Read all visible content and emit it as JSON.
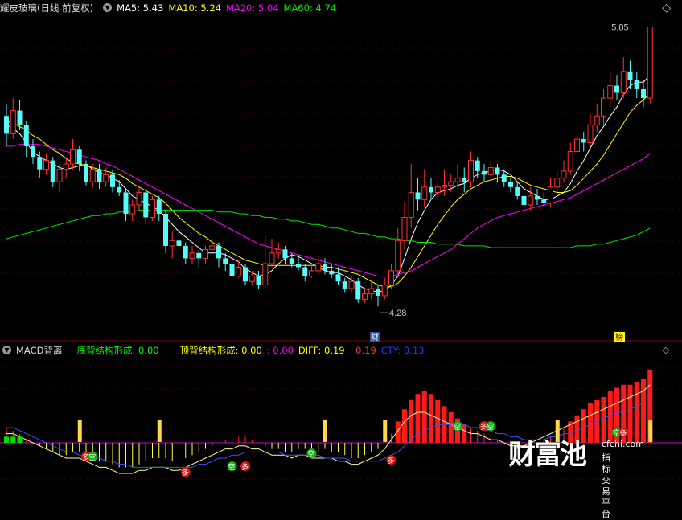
{
  "header": {
    "stock_name": "耀皮玻璃(日线 前复权)",
    "ma5": "MA5: 5.43",
    "ma10": "MA10: 5.24",
    "ma20": "MA20: 5.04",
    "ma60": "MA60: 4.74"
  },
  "indicator_header": {
    "name": "MACD背离",
    "bottom_div": "底背结构形成: 0.00",
    "top_div": "顶背结构形成: 0.00",
    "val3": ": 0.00",
    "diff": "DIFF: 0.19",
    "val5": ": 0.19",
    "cty": "CTY: 0.13"
  },
  "colors": {
    "up": "#ff3232",
    "down": "#54fcfc",
    "ma5": "#ffffff",
    "ma10": "#ffff00",
    "ma20": "#ff00ff",
    "ma60": "#00e600",
    "diff_label": "#00ff00"
  },
  "annotations": {
    "high_label": "5.85",
    "low_label": "4.28",
    "cai_badge": "财",
    "rong_badge": "榜",
    "duo": "多",
    "kong": "空"
  },
  "watermark": {
    "big": "财富池",
    "url": "cfchi.com",
    "slogan": "指标交易平台"
  },
  "chart_data": {
    "type": "candlestick",
    "high_marker": 5.85,
    "low_marker": 4.28,
    "candles": [
      [
        0,
        5.35,
        5.25,
        5.42,
        5.18
      ],
      [
        1,
        5.25,
        5.38,
        5.45,
        5.22
      ],
      [
        2,
        5.38,
        5.3,
        5.44,
        5.27
      ],
      [
        3,
        5.3,
        5.18,
        5.32,
        5.12
      ],
      [
        4,
        5.18,
        5.12,
        5.22,
        5.08
      ],
      [
        5,
        5.12,
        5.05,
        5.15,
        5.0
      ],
      [
        6,
        5.05,
        5.1,
        5.14,
        5.02
      ],
      [
        7,
        5.1,
        4.98,
        5.12,
        4.95
      ],
      [
        8,
        4.98,
        5.05,
        5.08,
        4.92
      ],
      [
        9,
        5.05,
        5.08,
        5.12,
        5.0
      ],
      [
        10,
        5.08,
        5.16,
        5.22,
        5.05
      ],
      [
        11,
        5.16,
        5.08,
        5.18,
        5.04
      ],
      [
        12,
        5.08,
        4.98,
        5.1,
        4.96
      ],
      [
        13,
        4.98,
        5.05,
        5.08,
        4.95
      ],
      [
        14,
        5.05,
        4.98,
        5.08,
        4.94
      ],
      [
        15,
        4.98,
        5.02,
        5.06,
        4.95
      ],
      [
        16,
        5.02,
        4.95,
        5.05,
        4.92
      ],
      [
        17,
        4.95,
        4.92,
        4.99,
        4.9
      ],
      [
        18,
        4.92,
        4.8,
        4.94,
        4.76
      ],
      [
        19,
        4.8,
        4.85,
        4.88,
        4.76
      ],
      [
        20,
        4.85,
        4.92,
        4.96,
        4.82
      ],
      [
        21,
        4.92,
        4.78,
        4.94,
        4.74
      ],
      [
        22,
        4.78,
        4.88,
        4.9,
        4.76
      ],
      [
        23,
        4.88,
        4.8,
        4.9,
        4.76
      ],
      [
        24,
        4.8,
        4.62,
        4.82,
        4.58
      ],
      [
        25,
        4.62,
        4.65,
        4.7,
        4.55
      ],
      [
        26,
        4.65,
        4.62,
        4.68,
        4.6
      ],
      [
        27,
        4.62,
        4.55,
        4.64,
        4.52
      ],
      [
        28,
        4.55,
        4.58,
        4.62,
        4.52
      ],
      [
        29,
        4.58,
        4.55,
        4.6,
        4.5
      ],
      [
        30,
        4.55,
        4.6,
        4.62,
        4.52
      ],
      [
        31,
        4.6,
        4.62,
        4.66,
        4.58
      ],
      [
        32,
        4.62,
        4.55,
        4.64,
        4.5
      ],
      [
        33,
        4.55,
        4.52,
        4.58,
        4.48
      ],
      [
        34,
        4.52,
        4.45,
        4.54,
        4.42
      ],
      [
        35,
        4.45,
        4.5,
        4.54,
        4.44
      ],
      [
        36,
        4.5,
        4.42,
        4.52,
        4.4
      ],
      [
        37,
        4.42,
        4.45,
        4.48,
        4.4
      ],
      [
        38,
        4.45,
        4.4,
        4.48,
        4.38
      ],
      [
        39,
        4.4,
        4.52,
        4.68,
        4.38
      ],
      [
        40,
        4.52,
        4.58,
        4.66,
        4.5
      ],
      [
        41,
        4.58,
        4.6,
        4.64,
        4.55
      ],
      [
        42,
        4.6,
        4.55,
        4.62,
        4.52
      ],
      [
        43,
        4.55,
        4.52,
        4.58,
        4.5
      ],
      [
        44,
        4.52,
        4.5,
        4.56,
        4.48
      ],
      [
        45,
        4.5,
        4.45,
        4.52,
        4.42
      ],
      [
        46,
        4.45,
        4.48,
        4.52,
        4.44
      ],
      [
        47,
        4.48,
        4.52,
        4.56,
        4.46
      ],
      [
        48,
        4.52,
        4.48,
        4.55,
        4.46
      ],
      [
        49,
        4.48,
        4.46,
        4.52,
        4.44
      ],
      [
        50,
        4.46,
        4.42,
        4.5,
        4.4
      ],
      [
        51,
        4.42,
        4.38,
        4.44,
        4.36
      ],
      [
        52,
        4.38,
        4.42,
        4.45,
        4.36
      ],
      [
        53,
        4.42,
        4.32,
        4.44,
        4.3
      ],
      [
        54,
        4.32,
        4.35,
        4.38,
        4.3
      ],
      [
        55,
        4.35,
        4.38,
        4.42,
        4.32
      ],
      [
        56,
        4.38,
        4.34,
        4.4,
        4.28
      ],
      [
        57,
        4.34,
        4.4,
        4.44,
        4.32
      ],
      [
        58,
        4.4,
        4.48,
        4.52,
        4.38
      ],
      [
        59,
        4.48,
        4.65,
        4.72,
        4.46
      ],
      [
        60,
        4.65,
        4.78,
        4.86,
        4.6
      ],
      [
        61,
        4.78,
        4.92,
        5.08,
        4.72
      ],
      [
        62,
        4.92,
        4.88,
        5.0,
        4.82
      ],
      [
        63,
        4.88,
        4.95,
        5.05,
        4.84
      ],
      [
        64,
        4.95,
        4.92,
        5.0,
        4.88
      ],
      [
        65,
        4.92,
        4.95,
        4.98,
        4.88
      ],
      [
        66,
        4.95,
        4.96,
        5.05,
        4.9
      ],
      [
        67,
        4.96,
        4.98,
        5.02,
        4.92
      ],
      [
        68,
        4.98,
        5.0,
        5.08,
        4.94
      ],
      [
        69,
        5.0,
        4.98,
        5.06,
        4.92
      ],
      [
        70,
        4.98,
        5.1,
        5.15,
        4.95
      ],
      [
        71,
        5.1,
        5.04,
        5.12,
        5.0
      ],
      [
        72,
        5.04,
        5.02,
        5.08,
        4.98
      ],
      [
        73,
        5.02,
        5.06,
        5.1,
        5.0
      ],
      [
        74,
        5.06,
        5.02,
        5.08,
        4.98
      ],
      [
        75,
        5.02,
        4.98,
        5.05,
        4.95
      ],
      [
        76,
        4.98,
        4.95,
        5.0,
        4.92
      ],
      [
        77,
        4.95,
        4.9,
        4.98,
        4.88
      ],
      [
        78,
        4.9,
        4.85,
        4.92,
        4.82
      ],
      [
        79,
        4.85,
        4.9,
        4.95,
        4.82
      ],
      [
        80,
        4.9,
        4.88,
        4.94,
        4.85
      ],
      [
        81,
        4.88,
        4.86,
        4.92,
        4.84
      ],
      [
        82,
        4.86,
        4.95,
        5.0,
        4.84
      ],
      [
        83,
        4.95,
        5.0,
        5.04,
        4.92
      ],
      [
        84,
        5.0,
        5.04,
        5.1,
        4.98
      ],
      [
        85,
        5.04,
        5.15,
        5.2,
        5.02
      ],
      [
        86,
        5.15,
        5.22,
        5.3,
        5.12
      ],
      [
        87,
        5.22,
        5.2,
        5.26,
        5.15
      ],
      [
        88,
        5.2,
        5.3,
        5.36,
        5.18
      ],
      [
        89,
        5.3,
        5.35,
        5.42,
        5.26
      ],
      [
        90,
        5.35,
        5.45,
        5.5,
        5.3
      ],
      [
        91,
        5.45,
        5.52,
        5.6,
        5.4
      ],
      [
        92,
        5.52,
        5.48,
        5.58,
        5.44
      ],
      [
        93,
        5.48,
        5.6,
        5.68,
        5.45
      ],
      [
        94,
        5.6,
        5.55,
        5.66,
        5.5
      ],
      [
        95,
        5.55,
        5.5,
        5.6,
        5.45
      ],
      [
        96,
        5.5,
        5.45,
        5.55,
        5.4
      ],
      [
        97,
        5.45,
        5.85,
        5.85,
        5.42
      ]
    ],
    "ma_series": [
      {
        "name": "MA5",
        "values": [
          5.3,
          5.28,
          5.25,
          5.2,
          5.15,
          5.12,
          5.1,
          5.08,
          5.06,
          5.05,
          5.06,
          5.07,
          5.08,
          5.05,
          5.03,
          5.02,
          5.0,
          4.98,
          4.94,
          4.9,
          4.88,
          4.86,
          4.84,
          4.82,
          4.78,
          4.74,
          4.7,
          4.67,
          4.64,
          4.61,
          4.58,
          4.58,
          4.58,
          4.57,
          4.55,
          4.53,
          4.49,
          4.47,
          4.45,
          4.46,
          4.48,
          4.52,
          4.55,
          4.57,
          4.56,
          4.54,
          4.52,
          4.5,
          4.48,
          4.47,
          4.47,
          4.45,
          4.43,
          4.4,
          4.38,
          4.37,
          4.36,
          4.37,
          4.4,
          4.45,
          4.55,
          4.66,
          4.75,
          4.82,
          4.88,
          4.92,
          4.93,
          4.94,
          4.96,
          4.97,
          5.0,
          5.02,
          5.03,
          5.04,
          5.05,
          5.04,
          5.02,
          4.98,
          4.94,
          4.92,
          4.9,
          4.88,
          4.88,
          4.9,
          4.92,
          4.97,
          5.04,
          5.1,
          5.17,
          5.24,
          5.29,
          5.35,
          5.4,
          5.47,
          5.52,
          5.54,
          5.54,
          5.58
        ]
      },
      {
        "name": "MA10",
        "values": [
          5.32,
          5.31,
          5.29,
          5.27,
          5.24,
          5.22,
          5.19,
          5.16,
          5.14,
          5.11,
          5.09,
          5.08,
          5.07,
          5.06,
          5.05,
          5.04,
          5.03,
          5.02,
          5.0,
          4.97,
          4.95,
          4.93,
          4.91,
          4.89,
          4.86,
          4.82,
          4.78,
          4.75,
          4.72,
          4.69,
          4.67,
          4.64,
          4.62,
          4.6,
          4.58,
          4.56,
          4.54,
          4.53,
          4.52,
          4.51,
          4.51,
          4.51,
          4.51,
          4.51,
          4.51,
          4.51,
          4.51,
          4.51,
          4.5,
          4.5,
          4.49,
          4.48,
          4.47,
          4.46,
          4.44,
          4.42,
          4.4,
          4.39,
          4.39,
          4.41,
          4.45,
          4.5,
          4.56,
          4.62,
          4.68,
          4.74,
          4.79,
          4.84,
          4.88,
          4.91,
          4.94,
          4.96,
          4.98,
          4.99,
          5.0,
          5.01,
          5.01,
          5.0,
          4.98,
          4.96,
          4.95,
          4.94,
          4.93,
          4.92,
          4.92,
          4.93,
          4.96,
          5.0,
          5.04,
          5.08,
          5.13,
          5.19,
          5.25,
          5.31,
          5.37,
          5.41,
          5.44,
          5.48
        ]
      },
      {
        "name": "MA20",
        "values": [
          5.18,
          5.18,
          5.19,
          5.19,
          5.19,
          5.19,
          5.18,
          5.17,
          5.16,
          5.15,
          5.14,
          5.13,
          5.12,
          5.11,
          5.1,
          5.08,
          5.07,
          5.05,
          5.03,
          5.01,
          4.99,
          4.97,
          4.95,
          4.93,
          4.91,
          4.89,
          4.87,
          4.85,
          4.83,
          4.81,
          4.79,
          4.77,
          4.75,
          4.73,
          4.71,
          4.69,
          4.67,
          4.65,
          4.63,
          4.62,
          4.61,
          4.6,
          4.59,
          4.58,
          4.57,
          4.56,
          4.55,
          4.54,
          4.53,
          4.52,
          4.51,
          4.5,
          4.49,
          4.48,
          4.47,
          4.46,
          4.45,
          4.45,
          4.45,
          4.46,
          4.47,
          4.48,
          4.5,
          4.52,
          4.54,
          4.56,
          4.58,
          4.6,
          4.63,
          4.66,
          4.69,
          4.72,
          4.74,
          4.76,
          4.78,
          4.79,
          4.8,
          4.81,
          4.82,
          4.83,
          4.84,
          4.85,
          4.86,
          4.87,
          4.88,
          4.89,
          4.91,
          4.93,
          4.95,
          4.97,
          4.99,
          5.01,
          5.03,
          5.05,
          5.07,
          5.09,
          5.11,
          5.14
        ]
      },
      {
        "name": "MA60",
        "values": [
          4.66,
          4.67,
          4.68,
          4.69,
          4.7,
          4.71,
          4.72,
          4.73,
          4.74,
          4.75,
          4.76,
          4.77,
          4.78,
          4.79,
          4.79,
          4.8,
          4.8,
          4.81,
          4.81,
          4.81,
          4.82,
          4.82,
          4.82,
          4.82,
          4.82,
          4.82,
          4.82,
          4.82,
          4.82,
          4.82,
          4.82,
          4.82,
          4.81,
          4.81,
          4.81,
          4.8,
          4.8,
          4.79,
          4.79,
          4.78,
          4.78,
          4.77,
          4.77,
          4.76,
          4.76,
          4.75,
          4.74,
          4.74,
          4.73,
          4.72,
          4.72,
          4.71,
          4.7,
          4.69,
          4.69,
          4.68,
          4.67,
          4.67,
          4.66,
          4.66,
          4.65,
          4.65,
          4.64,
          4.64,
          4.64,
          4.63,
          4.63,
          4.63,
          4.63,
          4.62,
          4.62,
          4.62,
          4.62,
          4.61,
          4.61,
          4.61,
          4.61,
          4.61,
          4.61,
          4.61,
          4.61,
          4.61,
          4.61,
          4.61,
          4.61,
          4.61,
          4.62,
          4.62,
          4.62,
          4.63,
          4.63,
          4.64,
          4.65,
          4.66,
          4.67,
          4.68,
          4.7,
          4.72
        ]
      }
    ],
    "macd_hist": [
      0.05,
      0.04,
      0.03,
      0.01,
      0.0,
      -0.01,
      -0.02,
      -0.03,
      -0.04,
      -0.04,
      -0.03,
      -0.03,
      -0.04,
      -0.05,
      -0.06,
      -0.06,
      -0.07,
      -0.08,
      -0.08,
      -0.08,
      -0.07,
      -0.06,
      -0.05,
      -0.05,
      -0.05,
      -0.06,
      -0.06,
      -0.05,
      -0.04,
      -0.03,
      -0.02,
      -0.01,
      0.0,
      0.01,
      0.01,
      0.02,
      0.02,
      0.01,
      0.0,
      -0.01,
      -0.02,
      -0.02,
      -0.03,
      -0.03,
      -0.02,
      -0.02,
      -0.03,
      -0.03,
      -0.02,
      -0.03,
      -0.03,
      -0.04,
      -0.05,
      -0.05,
      -0.04,
      -0.03,
      -0.02,
      0.0,
      0.03,
      0.07,
      0.11,
      0.14,
      0.16,
      0.17,
      0.16,
      0.14,
      0.12,
      0.1,
      0.08,
      0.06,
      0.05,
      0.04,
      0.03,
      0.02,
      0.01,
      0.0,
      -0.01,
      -0.02,
      -0.02,
      -0.01,
      0.0,
      0.01,
      0.02,
      0.04,
      0.05,
      0.07,
      0.09,
      0.11,
      0.13,
      0.14,
      0.15,
      0.17,
      0.18,
      0.19,
      0.19,
      0.2,
      0.21,
      0.24
    ],
    "diff_series": [
      0.03,
      0.03,
      0.02,
      0.01,
      0.0,
      -0.01,
      -0.02,
      -0.03,
      -0.04,
      -0.05,
      -0.05,
      -0.05,
      -0.06,
      -0.07,
      -0.08,
      -0.08,
      -0.09,
      -0.1,
      -0.1,
      -0.1,
      -0.09,
      -0.09,
      -0.08,
      -0.08,
      -0.08,
      -0.09,
      -0.09,
      -0.08,
      -0.07,
      -0.06,
      -0.05,
      -0.04,
      -0.03,
      -0.02,
      -0.02,
      -0.01,
      -0.01,
      -0.02,
      -0.02,
      -0.03,
      -0.04,
      -0.04,
      -0.04,
      -0.05,
      -0.04,
      -0.04,
      -0.05,
      -0.05,
      -0.05,
      -0.05,
      -0.06,
      -0.06,
      -0.07,
      -0.07,
      -0.06,
      -0.05,
      -0.04,
      -0.02,
      0.01,
      0.04,
      0.07,
      0.09,
      0.1,
      0.1,
      0.09,
      0.08,
      0.07,
      0.06,
      0.05,
      0.04,
      0.03,
      0.03,
      0.02,
      0.01,
      0.01,
      0.0,
      -0.01,
      -0.01,
      -0.01,
      0.0,
      0.01,
      0.02,
      0.03,
      0.04,
      0.05,
      0.06,
      0.07,
      0.08,
      0.09,
      0.1,
      0.11,
      0.12,
      0.13,
      0.14,
      0.15,
      0.16,
      0.17,
      0.19
    ],
    "dea_series": [
      0.05,
      0.05,
      0.04,
      0.03,
      0.02,
      0.01,
      0.0,
      -0.01,
      -0.02,
      -0.03,
      -0.03,
      -0.04,
      -0.04,
      -0.05,
      -0.05,
      -0.06,
      -0.06,
      -0.07,
      -0.07,
      -0.08,
      -0.08,
      -0.08,
      -0.08,
      -0.08,
      -0.08,
      -0.08,
      -0.08,
      -0.08,
      -0.08,
      -0.07,
      -0.07,
      -0.06,
      -0.05,
      -0.05,
      -0.04,
      -0.04,
      -0.03,
      -0.03,
      -0.03,
      -0.03,
      -0.03,
      -0.03,
      -0.04,
      -0.04,
      -0.04,
      -0.04,
      -0.04,
      -0.04,
      -0.05,
      -0.05,
      -0.05,
      -0.05,
      -0.06,
      -0.06,
      -0.06,
      -0.06,
      -0.06,
      -0.05,
      -0.04,
      -0.03,
      -0.01,
      0.01,
      0.03,
      0.04,
      0.05,
      0.06,
      0.06,
      0.06,
      0.06,
      0.06,
      0.05,
      0.05,
      0.04,
      0.04,
      0.03,
      0.03,
      0.02,
      0.02,
      0.01,
      0.01,
      0.01,
      0.01,
      0.02,
      0.02,
      0.03,
      0.03,
      0.04,
      0.05,
      0.06,
      0.07,
      0.08,
      0.09,
      0.1,
      0.1,
      0.11,
      0.12,
      0.13,
      0.13
    ]
  }
}
